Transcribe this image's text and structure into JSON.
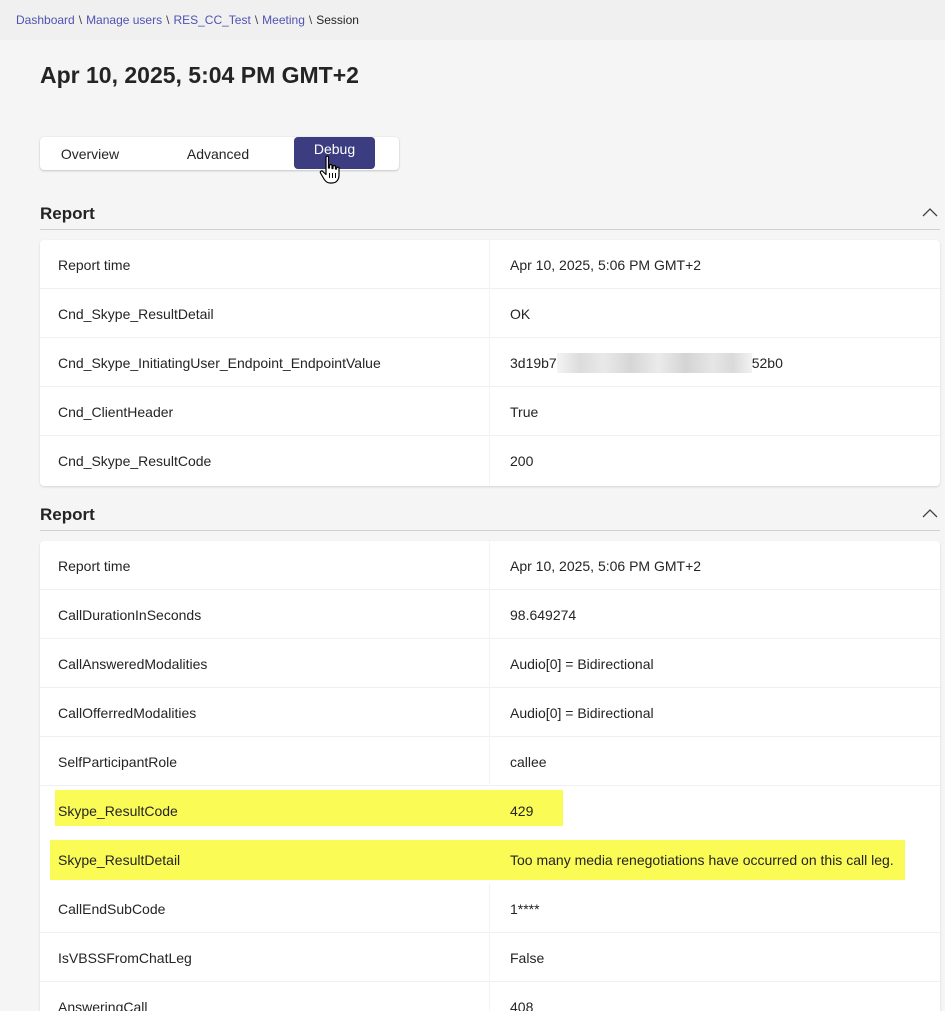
{
  "breadcrumb": {
    "items": [
      "Dashboard",
      "Manage users",
      "RES_CC_Test",
      "Meeting"
    ],
    "current": "Session",
    "separator": "\\"
  },
  "page": {
    "title": "Apr 10, 2025, 5:04 PM GMT+2"
  },
  "tabs": {
    "overview": "Overview",
    "advanced": "Advanced",
    "debug": "Debug",
    "selected": "Debug"
  },
  "colors": {
    "accent": "#3b3d80",
    "highlight": "#fbfb56",
    "link": "#4f52b2"
  },
  "report1": {
    "title": "Report",
    "rows": [
      {
        "key": "Report time",
        "value": "Apr 10, 2025, 5:06 PM GMT+2"
      },
      {
        "key": "Cnd_Skype_ResultDetail",
        "value": "OK"
      },
      {
        "key": "Cnd_Skype_InitiatingUser_Endpoint_EndpointValue",
        "value_start": "3d19b7",
        "value_end": "52b0"
      },
      {
        "key": "Cnd_ClientHeader",
        "value": "True"
      },
      {
        "key": "Cnd_Skype_ResultCode",
        "value": "200"
      }
    ]
  },
  "report2": {
    "title": "Report",
    "rows": [
      {
        "key": "Report time",
        "value": "Apr 10, 2025, 5:06 PM GMT+2"
      },
      {
        "key": "CallDurationInSeconds",
        "value": "98.649274"
      },
      {
        "key": "CallAnsweredModalities",
        "value": "Audio[0] = Bidirectional"
      },
      {
        "key": "CallOfferredModalities",
        "value": "Audio[0] = Bidirectional"
      },
      {
        "key": "SelfParticipantRole",
        "value": "callee"
      },
      {
        "key": "Skype_ResultCode",
        "value": "429"
      },
      {
        "key": "Skype_ResultDetail",
        "value": "Too many media renegotiations have occurred on this call leg."
      },
      {
        "key": "CallEndSubCode",
        "value": "1****"
      },
      {
        "key": "IsVBSSFromChatLeg",
        "value": "False"
      },
      {
        "key": "AnsweringCall",
        "value": "408"
      }
    ]
  }
}
